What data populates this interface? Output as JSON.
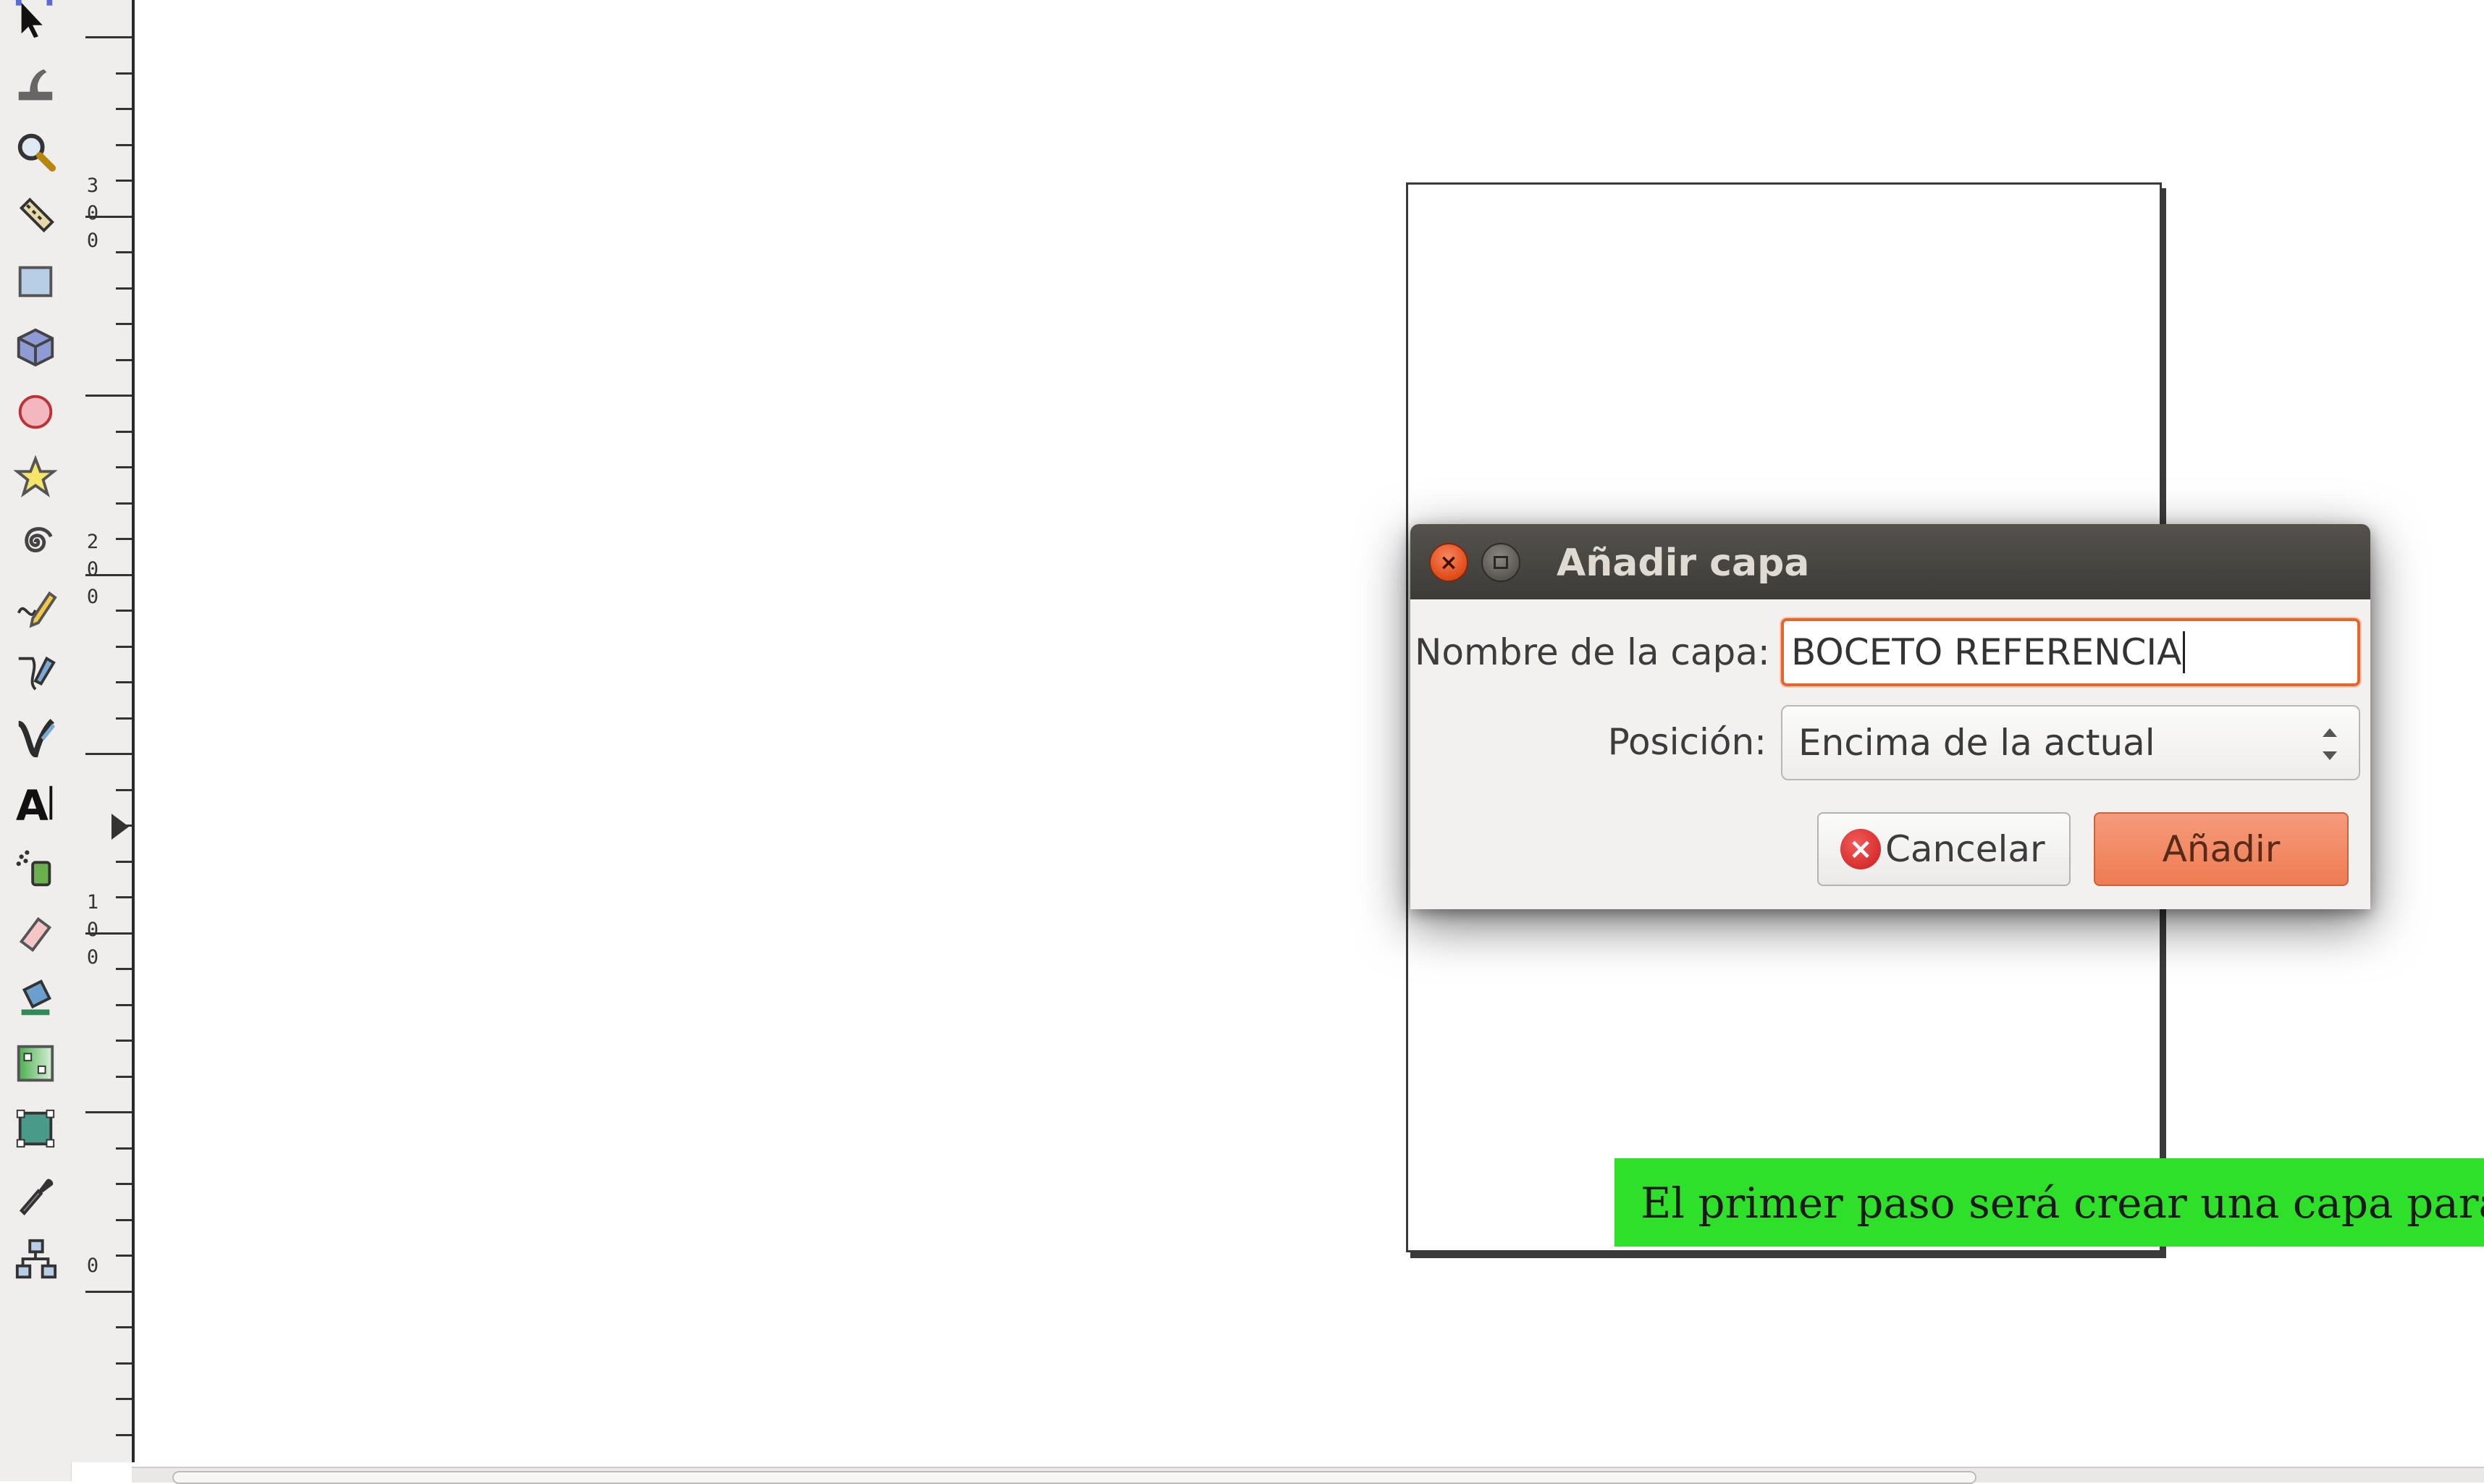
{
  "toolbox": {
    "tools": [
      "selector-tool-icon",
      "tweak-tool-icon",
      "zoom-tool-icon",
      "measure-tool-icon",
      "rectangle-tool-icon",
      "3d-box-tool-icon",
      "ellipse-tool-icon",
      "star-tool-icon",
      "spiral-tool-icon",
      "pencil-tool-icon",
      "pen-tool-icon",
      "calligraphy-tool-icon",
      "text-tool-icon",
      "spray-tool-icon",
      "eraser-tool-icon",
      "paint-bucket-tool-icon",
      "gradient-tool-icon",
      "mesh-tool-icon",
      "dropper-tool-icon",
      "connector-tool-icon"
    ]
  },
  "ruler": {
    "labels": [
      "3\n0\n0",
      "2\n0\n0",
      "1\n0\n0",
      "0"
    ]
  },
  "caption": {
    "text": "El primer paso será crear una capa para"
  },
  "dialog": {
    "title": "Añadir capa",
    "name_label": "Nombre de la capa:",
    "name_value": "BOCETO REFERENCIA",
    "position_label": "Posición:",
    "position_value": "Encima de la actual",
    "cancel_label": "Cancelar",
    "add_label": "Añadir",
    "close_glyph": "×"
  },
  "colors": {
    "accent": "#ee7c52",
    "caption_bg": "#2fe02a",
    "titlebar": "#3c3b37"
  }
}
